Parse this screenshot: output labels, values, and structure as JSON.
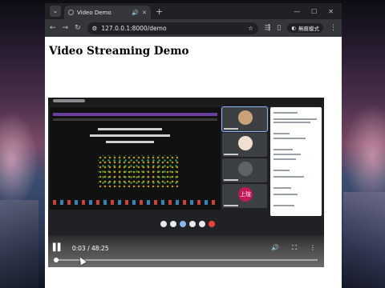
{
  "browser": {
    "tab_title": "Video Demo",
    "new_tab_glyph": "+",
    "url": "127.0.0.1:8000/demo",
    "profile_label": "無痕模式"
  },
  "page": {
    "heading": "Video Streaming Demo"
  },
  "video": {
    "current_time": "0:03",
    "duration": "48:25",
    "time_display": "0:03 / 48:25",
    "progress_fraction": 0.0,
    "state": "paused",
    "tile_initials": "上瑄"
  },
  "icons": {
    "tab_menu": "chevron-down-icon",
    "back": "back-arrow-icon",
    "forward": "forward-arrow-icon",
    "reload": "reload-icon",
    "site_info": "site-info-icon",
    "play_pause": "pause-icon",
    "volume": "volume-icon",
    "fullscreen": "fullscreen-icon",
    "more": "more-vert-icon"
  }
}
